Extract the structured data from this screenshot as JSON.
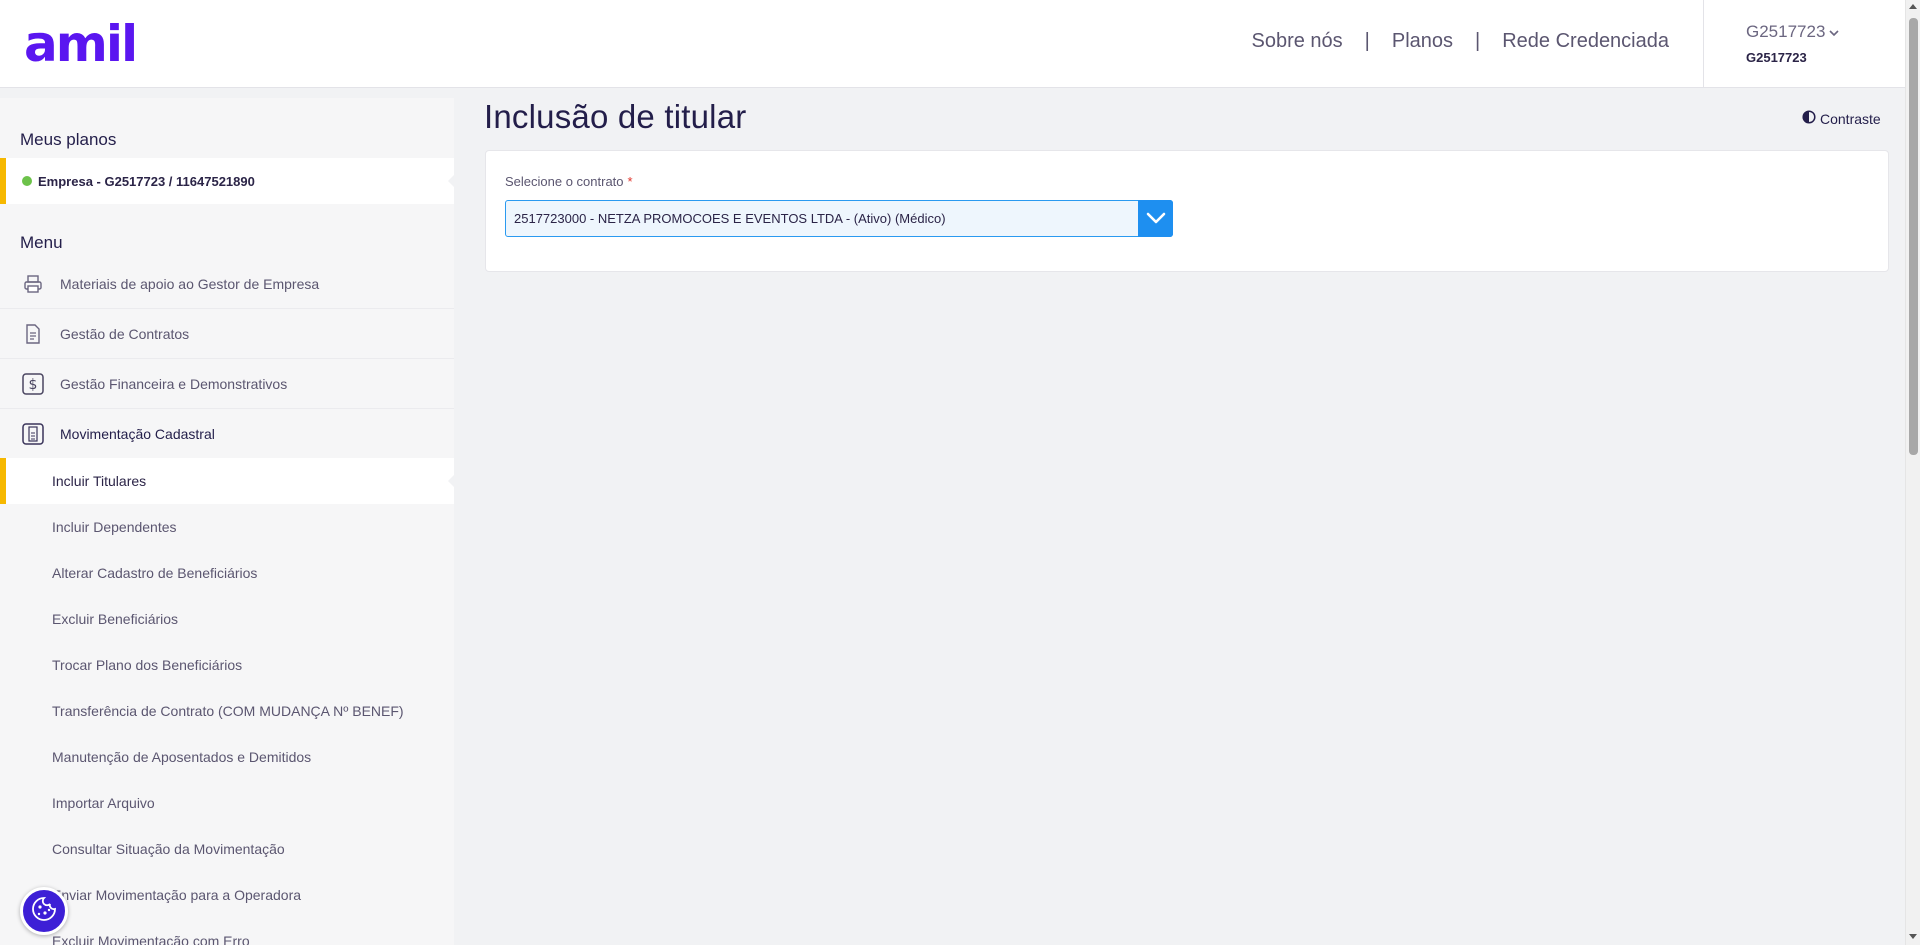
{
  "header": {
    "logo": "amil",
    "nav": [
      "Sobre nós",
      "Planos",
      "Rede Credenciada"
    ],
    "separator": "|",
    "user_name": "G2517723",
    "user_id": "G2517723"
  },
  "sidebar": {
    "plans_heading": "Meus planos",
    "plan_label": "Empresa - G2517723 / 11647521890",
    "menu_heading": "Menu",
    "menu_items": [
      {
        "label": "Materiais de apoio ao Gestor de Empresa",
        "icon": "printer-icon"
      },
      {
        "label": "Gestão de Contratos",
        "icon": "document-icon"
      },
      {
        "label": "Gestão Financeira e Demonstrativos",
        "icon": "dollar-icon"
      },
      {
        "label": "Movimentação Cadastral",
        "icon": "clipboard-icon"
      }
    ],
    "sub_items": [
      "Incluir Titulares",
      "Incluir Dependentes",
      "Alterar Cadastro de Beneficiários",
      "Excluir Beneficiários",
      "Trocar Plano dos Beneficiários",
      "Transferência de Contrato (COM MUDANÇA Nº BENEF)",
      "Manutenção de Aposentados e Demitidos",
      "Importar Arquivo",
      "Consultar Situação da Movimentação",
      "Enviar Movimentação para a Operadora",
      "Excluir Movimentação com Erro"
    ],
    "active_sub_item": "Incluir Titulares"
  },
  "main": {
    "title": "Inclusão de titular",
    "contrast_label": "Contraste",
    "contract_label": "Selecione o contrato",
    "required_marker": "*",
    "contract_value": "2517723000 - NETZA PROMOCOES E EVENTOS LTDA - (Ativo) (Médico)"
  },
  "colors": {
    "brand": "#5a16f0",
    "active_marker": "#f6b800",
    "status_active": "#6cc24a",
    "select_accent": "#1e8ff0",
    "cookie_button": "#3d1fd6"
  }
}
